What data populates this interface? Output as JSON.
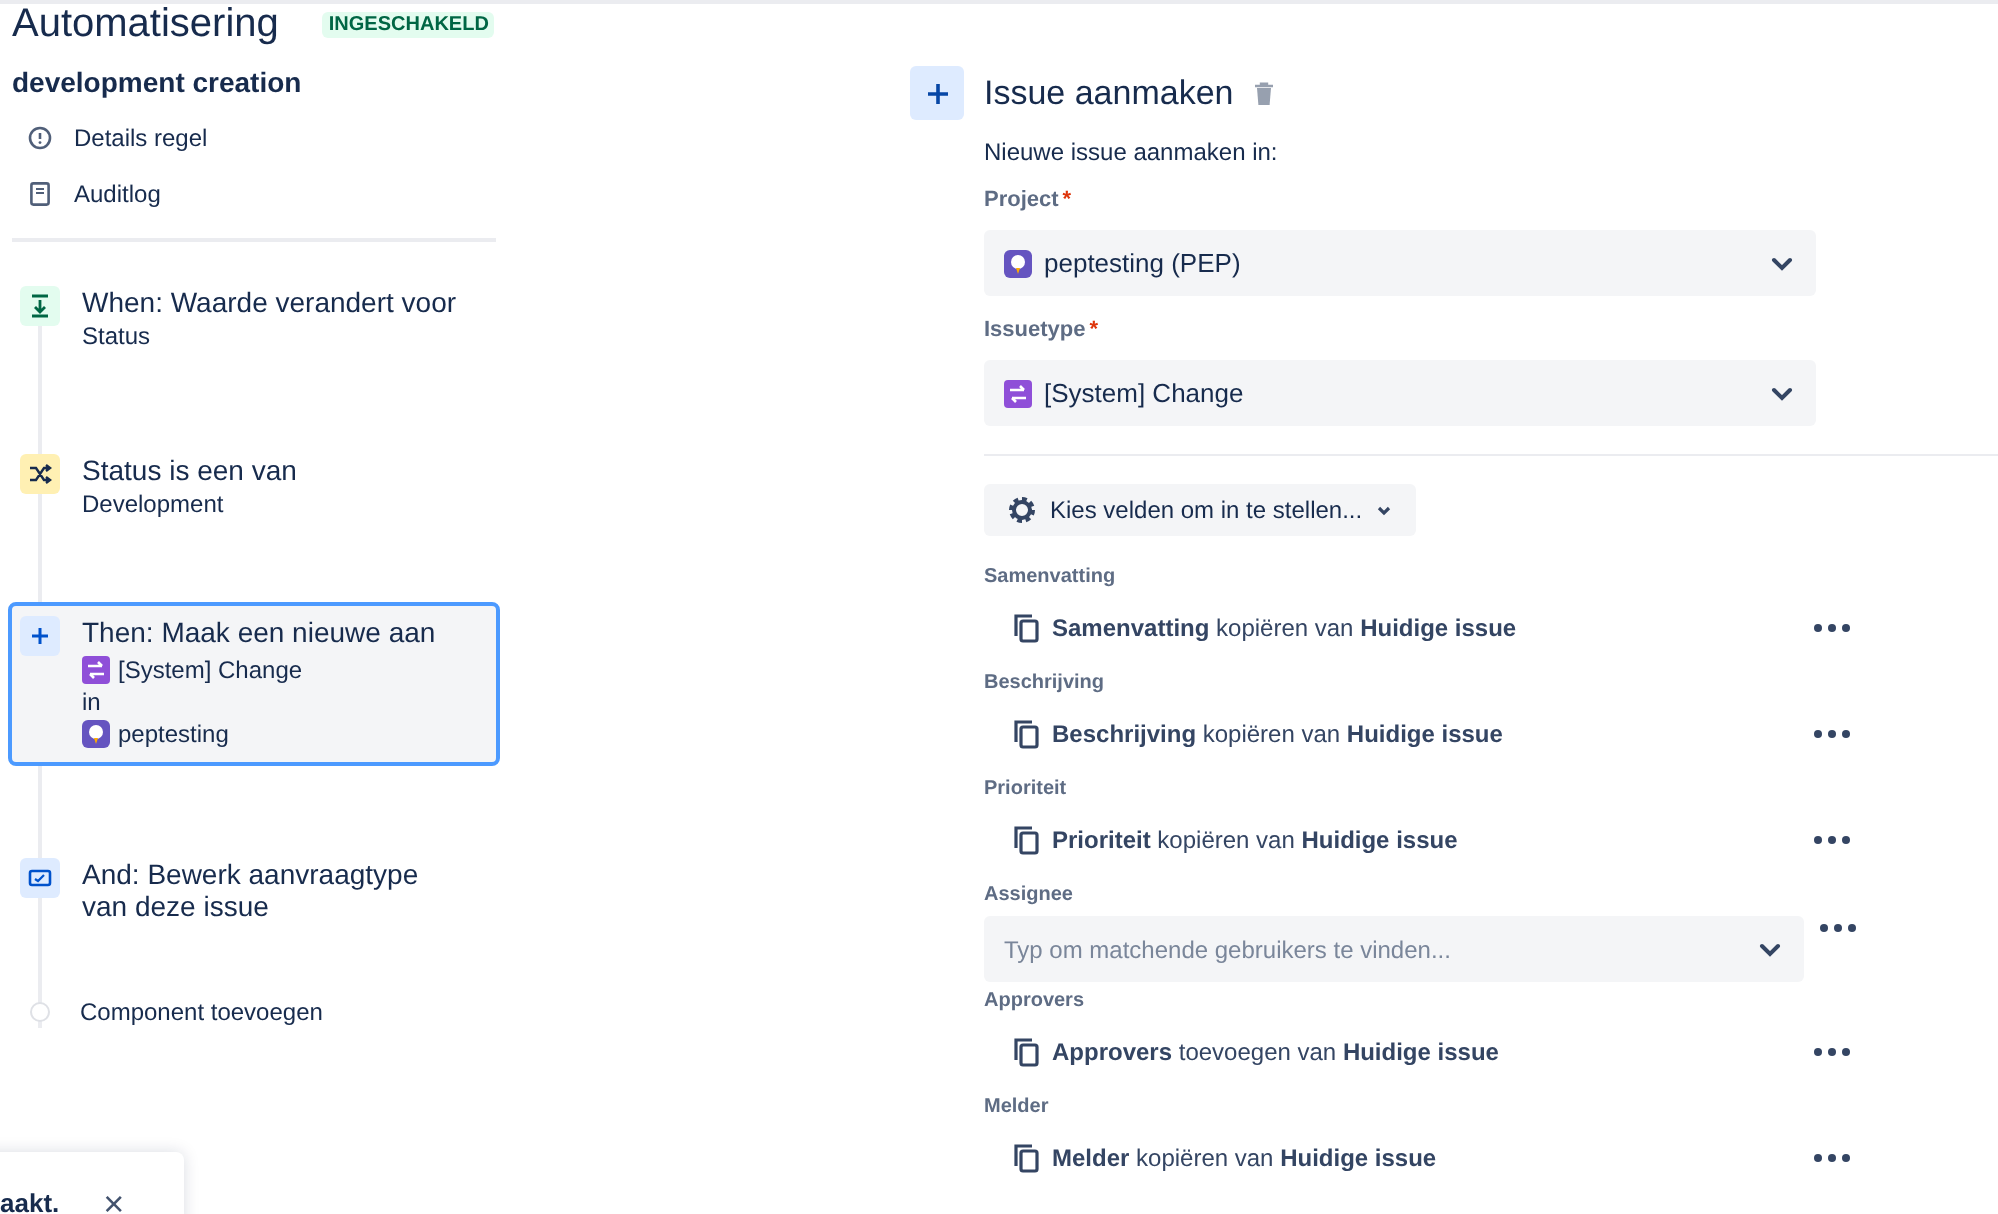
{
  "header": {
    "title": "Automatisering",
    "status_badge": "INGESCHAKELD"
  },
  "sidebar": {
    "rule_name": "development creation",
    "links": [
      {
        "kind": "info",
        "label": "Details regel"
      },
      {
        "kind": "log",
        "label": "Auditlog"
      }
    ],
    "steps": [
      {
        "kind": "trigger",
        "title": "When: Waarde verandert voor",
        "lines": [
          {
            "kind": "text",
            "text": "Status"
          }
        ],
        "selected": false
      },
      {
        "kind": "condition",
        "title": "Status is een van",
        "lines": [
          {
            "kind": "text",
            "text": "Development"
          }
        ],
        "selected": false
      },
      {
        "kind": "action",
        "title": "Then: Maak een nieuwe aan",
        "lines": [
          {
            "kind": "issuetype",
            "text": "[System] Change"
          },
          {
            "kind": "text",
            "text": "in"
          },
          {
            "kind": "project",
            "text": "peptesting"
          }
        ],
        "selected": true
      },
      {
        "kind": "edit",
        "title": "And: Bewerk aanvraagtype van deze issue",
        "selected": false
      }
    ],
    "add_component": "Component toevoegen"
  },
  "toast": {
    "message": "aakt.",
    "close": "×"
  },
  "panel": {
    "title": "Issue aanmaken",
    "intro": "Nieuwe issue aanmaken in:",
    "selects": [
      {
        "label": "Project",
        "required_mark": "*",
        "value": "peptesting (PEP)"
      },
      {
        "label": "Issuetype",
        "required_mark": "*",
        "value": "[System] Change"
      }
    ],
    "choose_fields_button": "Kies velden om in te stellen...",
    "fields": [
      {
        "kind": "copy",
        "label": "Samenvatting",
        "value": "**Samenvatting** kopiëren van **Huidige issue**"
      },
      {
        "kind": "copy",
        "label": "Beschrijving",
        "value": "**Beschrijving** kopiëren van **Huidige issue**"
      },
      {
        "kind": "copy",
        "label": "Prioriteit",
        "value": "**Prioriteit** kopiëren van **Huidige issue**"
      },
      {
        "kind": "select",
        "label": "Assignee",
        "placeholder": "Typ om matchende gebruikers te vinden..."
      },
      {
        "kind": "copy",
        "label": "Approvers",
        "value": "**Approvers** toevoegen van **Huidige issue**"
      },
      {
        "kind": "copy",
        "label": "Melder",
        "value": "**Melder** kopiëren van **Huidige issue**"
      }
    ]
  }
}
